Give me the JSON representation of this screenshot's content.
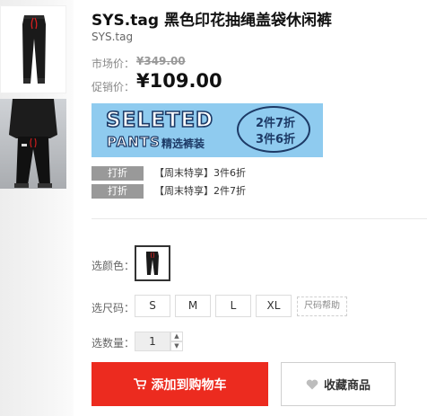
{
  "product": {
    "title": "SYS.tag 黑色印花抽绳盖袋休闲裤",
    "brand": "SYS.tag"
  },
  "prices": {
    "market_label": "市场价：",
    "market_price": "¥349.00",
    "sale_label": "促销价：",
    "sale_price": "¥109.00"
  },
  "banner": {
    "line1": "SELETED",
    "line2": "PANTS",
    "sub": "精选裤装",
    "circle_line1": "2件7折",
    "circle_line2": "3件6折"
  },
  "promotions": [
    {
      "tag": "打折",
      "text": "【周末特享】3件6折"
    },
    {
      "tag": "打折",
      "text": "【周末特享】2件7折"
    }
  ],
  "options": {
    "color_label": "选颜色：",
    "size_label": "选尺码：",
    "sizes": [
      "S",
      "M",
      "L",
      "XL"
    ],
    "size_help": "尺码帮助",
    "qty_label": "选数量：",
    "qty_value": "1"
  },
  "actions": {
    "add_to_cart": "添加到购物车",
    "favorite": "收藏商品"
  },
  "colors": {
    "accent": "#ec2b1f",
    "banner_bg": "#8fcbef",
    "banner_ink": "#1d3a66",
    "promo_tag_bg": "#999999"
  },
  "icons": {
    "cart": "cart-icon",
    "heart": "heart-icon",
    "up": "chevron-up-icon",
    "down": "chevron-down-icon"
  }
}
